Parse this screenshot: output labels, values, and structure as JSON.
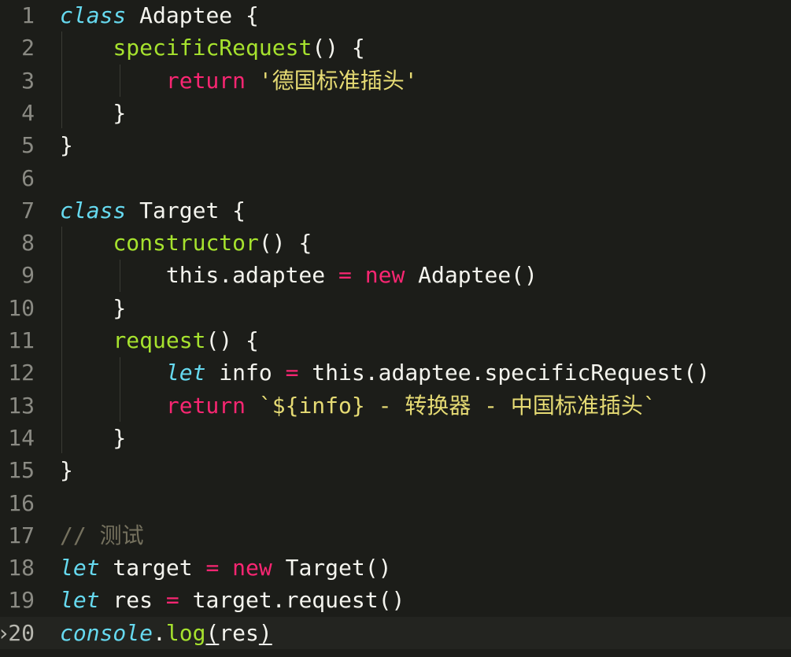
{
  "editor": {
    "current_line": 20,
    "lines": [
      {
        "n": "1",
        "t": [
          {
            "k": "kw-italic",
            "s": "class"
          },
          {
            "k": "txt",
            "s": " Adaptee {"
          }
        ]
      },
      {
        "n": "2",
        "t": [
          {
            "k": "txt",
            "s": "    "
          },
          {
            "k": "fn",
            "s": "specificRequest"
          },
          {
            "k": "txt",
            "s": "() {"
          }
        ]
      },
      {
        "n": "3",
        "t": [
          {
            "k": "txt",
            "s": "        "
          },
          {
            "k": "kw-pink",
            "s": "return"
          },
          {
            "k": "txt",
            "s": " "
          },
          {
            "k": "str",
            "s": "'德国标准插头'"
          }
        ]
      },
      {
        "n": "4",
        "t": [
          {
            "k": "txt",
            "s": "    }"
          }
        ]
      },
      {
        "n": "5",
        "t": [
          {
            "k": "txt",
            "s": "}"
          }
        ]
      },
      {
        "n": "6",
        "t": []
      },
      {
        "n": "7",
        "t": [
          {
            "k": "kw-italic",
            "s": "class"
          },
          {
            "k": "txt",
            "s": " Target {"
          }
        ]
      },
      {
        "n": "8",
        "t": [
          {
            "k": "txt",
            "s": "    "
          },
          {
            "k": "fn",
            "s": "constructor"
          },
          {
            "k": "txt",
            "s": "() {"
          }
        ]
      },
      {
        "n": "9",
        "t": [
          {
            "k": "txt",
            "s": "        this.adaptee "
          },
          {
            "k": "kw-pink",
            "s": "="
          },
          {
            "k": "txt",
            "s": " "
          },
          {
            "k": "kw-pink",
            "s": "new"
          },
          {
            "k": "txt",
            "s": " Adaptee()"
          }
        ]
      },
      {
        "n": "10",
        "t": [
          {
            "k": "txt",
            "s": "    }"
          }
        ]
      },
      {
        "n": "11",
        "t": [
          {
            "k": "txt",
            "s": "    "
          },
          {
            "k": "fn",
            "s": "request"
          },
          {
            "k": "txt",
            "s": "() {"
          }
        ]
      },
      {
        "n": "12",
        "t": [
          {
            "k": "txt",
            "s": "        "
          },
          {
            "k": "kw-italic",
            "s": "let"
          },
          {
            "k": "txt",
            "s": " info "
          },
          {
            "k": "kw-pink",
            "s": "="
          },
          {
            "k": "txt",
            "s": " this.adaptee.specificRequest()"
          }
        ]
      },
      {
        "n": "13",
        "t": [
          {
            "k": "txt",
            "s": "        "
          },
          {
            "k": "kw-pink",
            "s": "return"
          },
          {
            "k": "txt",
            "s": " "
          },
          {
            "k": "str",
            "s": "`${info} - 转换器 - 中国标准插头`"
          }
        ]
      },
      {
        "n": "14",
        "t": [
          {
            "k": "txt",
            "s": "    }"
          }
        ]
      },
      {
        "n": "15",
        "t": [
          {
            "k": "txt",
            "s": "}"
          }
        ]
      },
      {
        "n": "16",
        "t": []
      },
      {
        "n": "17",
        "t": [
          {
            "k": "cm",
            "s": "// 测试"
          }
        ]
      },
      {
        "n": "18",
        "t": [
          {
            "k": "kw-italic",
            "s": "let"
          },
          {
            "k": "txt",
            "s": " target "
          },
          {
            "k": "kw-pink",
            "s": "="
          },
          {
            "k": "txt",
            "s": " "
          },
          {
            "k": "kw-pink",
            "s": "new"
          },
          {
            "k": "txt",
            "s": " Target()"
          }
        ]
      },
      {
        "n": "19",
        "t": [
          {
            "k": "kw-italic",
            "s": "let"
          },
          {
            "k": "txt",
            "s": " res "
          },
          {
            "k": "kw-pink",
            "s": "="
          },
          {
            "k": "txt",
            "s": " target.request()"
          }
        ]
      },
      {
        "n": "20",
        "t": [
          {
            "k": "kw-italic",
            "s": "console"
          },
          {
            "k": "txt",
            "s": "."
          },
          {
            "k": "fn",
            "s": "log"
          },
          {
            "k": "txt ul",
            "s": "("
          },
          {
            "k": "txt",
            "s": "res"
          },
          {
            "k": "txt ul",
            "s": ")"
          }
        ]
      }
    ],
    "gutter_mark": "›"
  },
  "colors": {
    "background": "#1c1d19",
    "keyword_italic": "#66d9ef",
    "keyword_pink": "#f92672",
    "function": "#a6e22e",
    "string": "#e6db74",
    "comment": "#75715e",
    "text": "#f4f4ee",
    "line_number": "#8a8a83"
  }
}
